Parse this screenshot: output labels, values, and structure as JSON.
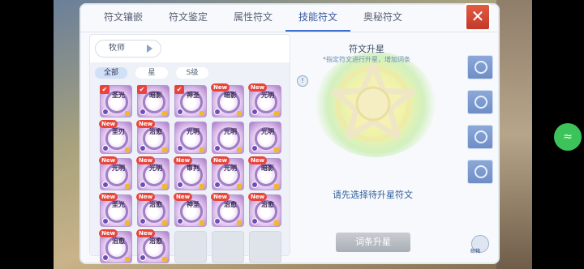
{
  "tabs": [
    {
      "label": "符文镶嵌",
      "active": false
    },
    {
      "label": "符文鉴定",
      "active": false
    },
    {
      "label": "属性符文",
      "active": false
    },
    {
      "label": "技能符文",
      "active": true
    },
    {
      "label": "奥秘符文",
      "active": false
    }
  ],
  "close_label": "✕",
  "class_select": {
    "value": "牧师"
  },
  "filters": [
    {
      "label": "全部",
      "active": true
    },
    {
      "label": "星",
      "active": false
    },
    {
      "label": "S级",
      "active": false
    }
  ],
  "runes": [
    {
      "name": "圣光",
      "new": false,
      "checked": true
    },
    {
      "name": "暗影",
      "new": false,
      "checked": true
    },
    {
      "name": "神圣",
      "new": false,
      "checked": true
    },
    {
      "name": "暗影",
      "new": true,
      "checked": false
    },
    {
      "name": "光明",
      "new": true,
      "checked": false
    },
    {
      "name": "圣刃",
      "new": true,
      "checked": false
    },
    {
      "name": "治愈",
      "new": true,
      "checked": false
    },
    {
      "name": "光明",
      "new": false,
      "checked": false
    },
    {
      "name": "光明",
      "new": false,
      "checked": false
    },
    {
      "name": "光明",
      "new": false,
      "checked": false
    },
    {
      "name": "光明",
      "new": true,
      "checked": false
    },
    {
      "name": "光明",
      "new": true,
      "checked": false
    },
    {
      "name": "审判",
      "new": true,
      "checked": false
    },
    {
      "name": "光明",
      "new": true,
      "checked": false
    },
    {
      "name": "暗影",
      "new": true,
      "checked": false
    },
    {
      "name": "圣光",
      "new": true,
      "checked": false
    },
    {
      "name": "治愈",
      "new": true,
      "checked": false
    },
    {
      "name": "神圣",
      "new": true,
      "checked": false
    },
    {
      "name": "治愈",
      "new": true,
      "checked": false
    },
    {
      "name": "治愈",
      "new": true,
      "checked": false
    },
    {
      "name": "治愈",
      "new": true,
      "checked": false
    },
    {
      "name": "治愈",
      "new": true,
      "checked": false
    },
    {
      "name": "",
      "new": false,
      "checked": false,
      "empty": true
    },
    {
      "name": "",
      "new": false,
      "checked": false,
      "empty": true
    },
    {
      "name": "",
      "new": false,
      "checked": false,
      "empty": true
    }
  ],
  "new_badge": "New",
  "check_mark": "✔",
  "upgrade": {
    "title": "符文升星",
    "subtitle": "*指定符文进行升星，增加词条",
    "prompt": "请先选择待升星符文",
    "button": "词条升星",
    "info": "!"
  },
  "mailbox_label": "邮箱",
  "side_tab_icons": [
    "rune-icon",
    "swirl-icon",
    "shield-icon",
    "compass-icon"
  ],
  "wifi_icon": "wifi-icon",
  "colors": {
    "accent": "#3c6fd0",
    "close": "#d8483a",
    "new_badge": "#e8453a",
    "rune_purple": "#a779c7"
  }
}
